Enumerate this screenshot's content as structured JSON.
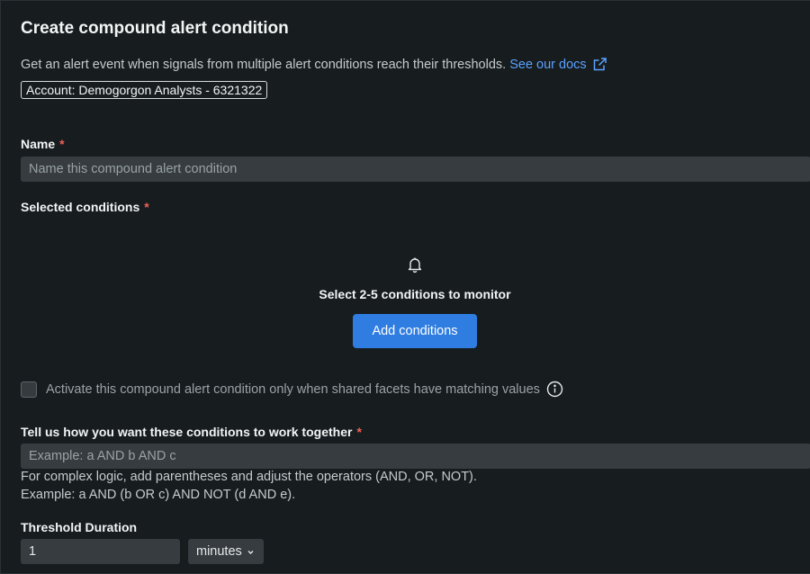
{
  "header": {
    "title": "Create compound alert condition",
    "description": "Get an alert event when signals from multiple alert conditions reach their thresholds.",
    "docs_link": "See our docs",
    "account": "Account: Demogorgon Analysts - 6321322"
  },
  "name_field": {
    "label": "Name",
    "required_mark": "*",
    "placeholder": "Name this compound alert condition",
    "value": ""
  },
  "selected_conditions": {
    "label": "Selected conditions",
    "required_mark": "*",
    "empty_message": "Select 2-5 conditions to monitor",
    "add_button": "Add conditions",
    "icon": "bell-icon"
  },
  "facets_option": {
    "label": "Activate this compound alert condition only when shared facets have matching values",
    "checked": false,
    "icon": "info-icon"
  },
  "logic_field": {
    "label": "Tell us how you want these conditions to work together",
    "required_mark": "*",
    "placeholder": "Example: a AND b AND c",
    "value": "",
    "help_line_1": "For complex logic, add parentheses and adjust the operators (AND, OR, NOT).",
    "help_line_2": "Example: a AND (b OR c) AND NOT (d AND e)."
  },
  "threshold": {
    "label": "Threshold Duration",
    "value": "1",
    "unit": "minutes"
  },
  "colors": {
    "background": "#171c1e",
    "input": "#363c40",
    "primary": "#2f7de1",
    "link": "#5aa2ff",
    "required": "#f0605a"
  }
}
